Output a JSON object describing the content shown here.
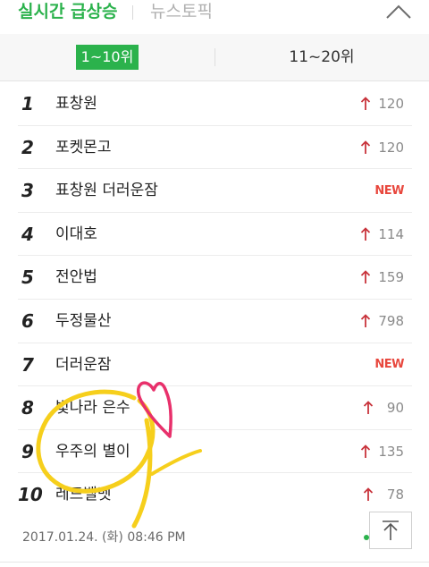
{
  "header": {
    "active_tab": "실시간 급상승",
    "inactive_tab": "뉴스토픽"
  },
  "range_tabs": {
    "active": "1~10위",
    "inactive": "11~20위"
  },
  "rankings": [
    {
      "rank": "1",
      "keyword": "표창원",
      "trend": "up",
      "change": "120"
    },
    {
      "rank": "2",
      "keyword": "포켓몬고",
      "trend": "up",
      "change": "120"
    },
    {
      "rank": "3",
      "keyword": "표창원 더러운잠",
      "trend": "new",
      "change": "NEW"
    },
    {
      "rank": "4",
      "keyword": "이대호",
      "trend": "up",
      "change": "114"
    },
    {
      "rank": "5",
      "keyword": "전안법",
      "trend": "up",
      "change": "159"
    },
    {
      "rank": "6",
      "keyword": "두정물산",
      "trend": "up",
      "change": "798"
    },
    {
      "rank": "7",
      "keyword": "더러운잠",
      "trend": "new",
      "change": "NEW"
    },
    {
      "rank": "8",
      "keyword": "빛나라 은수",
      "trend": "up",
      "change": "90"
    },
    {
      "rank": "9",
      "keyword": "우주의 별이",
      "trend": "up",
      "change": "135"
    },
    {
      "rank": "10",
      "keyword": "레드벨벳",
      "trend": "up",
      "change": "78"
    }
  ],
  "footer": {
    "timestamp": "2017.01.24. (화) 08:46 PM"
  },
  "icons": {
    "collapse": "chevron-up-icon",
    "trend_up": "arrow-up-icon",
    "scroll_top": "scroll-to-top-icon"
  },
  "colors": {
    "accent_green": "#2bb24c",
    "trend_up_red": "#c8333b",
    "new_red": "#e8473d",
    "doodle_yellow": "#f6cf1c",
    "doodle_pink": "#e8306b"
  }
}
